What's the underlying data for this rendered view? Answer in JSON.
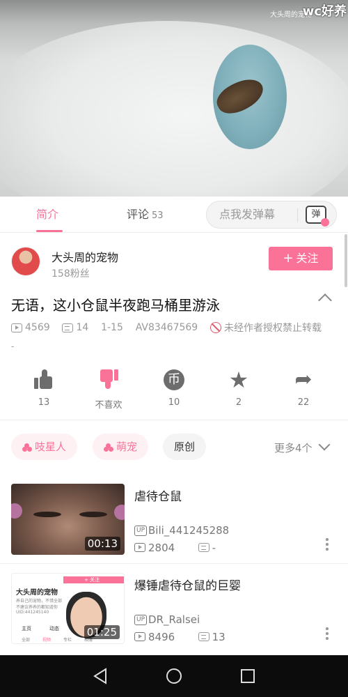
{
  "video": {
    "watermark_small": "大头周的宠物",
    "watermark_large": "wc好养"
  },
  "tabs": {
    "intro": "简介",
    "comments": "评论",
    "comments_count": "53",
    "danmaku_placeholder": "点我发弹幕",
    "danmaku_icon": "弹"
  },
  "author": {
    "name": "大头周的宠物",
    "fans": "158粉丝",
    "follow_label": "关注",
    "follow_plus": "+"
  },
  "video_info": {
    "title": "无语，这小仓鼠半夜跑马桶里游泳",
    "views": "4569",
    "danmaku_count": "14",
    "date": "1-15",
    "av_id": "AV83467569",
    "copyright": "未经作者授权禁止转载",
    "description": "-"
  },
  "actions": [
    {
      "label": "13"
    },
    {
      "label": "不喜欢"
    },
    {
      "label": "10",
      "icon_text": "币"
    },
    {
      "label": "2",
      "icon_text": "★"
    },
    {
      "label": "22",
      "icon_text": "➦"
    }
  ],
  "tags": {
    "items": [
      "吱星人",
      "萌宠",
      "原创"
    ],
    "more": "更多4个"
  },
  "related": [
    {
      "title": "虐待仓鼠",
      "duration": "00:13",
      "uploader": "Bili_441245288",
      "views": "2804",
      "danmaku": "-"
    },
    {
      "title": "爆锤虐待仓鼠的巨婴",
      "duration": "01:25",
      "uploader": "DR_Ralsei",
      "views": "8496",
      "danmaku": "13"
    }
  ],
  "thumb2_text": {
    "header": "+ 关注",
    "name": "大头周的宠物",
    "line1": "养自己的宠物，不惜全部",
    "line2": "不建议养养的都知道你",
    "line3": "UID:441245140",
    "tab1": "主页",
    "tab2": "动态",
    "tab3": "全部",
    "tab4": "视频",
    "tab5": "专栏",
    "tab6": "相簿"
  },
  "up_badge": "UP",
  "colors": {
    "accent": "#fb7299",
    "icon_gray": "#6d6d6d",
    "navbar": "#0c0c0c"
  },
  "icons": [
    "play-count-icon",
    "danmaku-count-icon",
    "forbid-icon",
    "like-icon",
    "dislike-icon",
    "coin-icon",
    "favorite-icon",
    "share-icon",
    "back-icon",
    "home-icon",
    "recent-icon",
    "kebab-icon",
    "chevron-up-icon",
    "chevron-down-icon"
  ]
}
